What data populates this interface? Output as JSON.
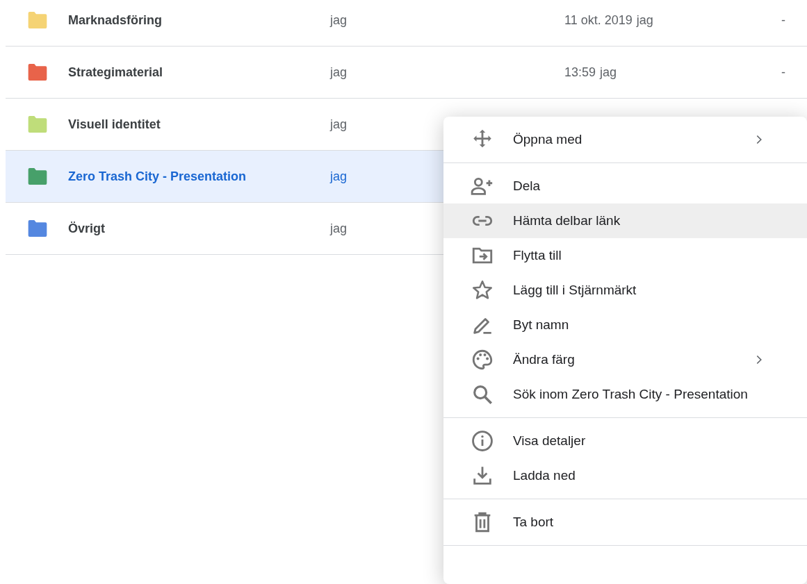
{
  "files": [
    {
      "name": "Marknadsföring",
      "color": "#f5d374",
      "owner": "jag",
      "modified": "11 okt. 2019",
      "modified_by": "jag",
      "size": "-",
      "selected": false
    },
    {
      "name": "Strategimaterial",
      "color": "#e8634a",
      "owner": "jag",
      "modified": "13:59",
      "modified_by": "jag",
      "size": "-",
      "selected": false
    },
    {
      "name": "Visuell identitet",
      "color": "#bfdd7a",
      "owner": "jag",
      "selected": false
    },
    {
      "name": "Zero Trash City - Presentation",
      "color": "#47a06a",
      "owner": "jag",
      "selected": true
    },
    {
      "name": "Övrigt",
      "color": "#5487e0",
      "owner": "jag",
      "selected": false
    }
  ],
  "context_menu": {
    "sections": [
      {
        "items": [
          {
            "kind": "open-with",
            "label": "Öppna med",
            "submenu": true,
            "highlighted": false
          }
        ]
      },
      {
        "items": [
          {
            "kind": "share",
            "label": "Dela",
            "submenu": false,
            "highlighted": false
          },
          {
            "kind": "link",
            "label": "Hämta delbar länk",
            "submenu": false,
            "highlighted": true
          },
          {
            "kind": "move",
            "label": "Flytta till",
            "submenu": false,
            "highlighted": false
          },
          {
            "kind": "star",
            "label": "Lägg till i Stjärnmärkt",
            "submenu": false,
            "highlighted": false
          },
          {
            "kind": "rename",
            "label": "Byt namn",
            "submenu": false,
            "highlighted": false
          },
          {
            "kind": "palette",
            "label": "Ändra färg",
            "submenu": true,
            "highlighted": false
          },
          {
            "kind": "search",
            "label": "Sök inom Zero Trash City - Presentation",
            "submenu": false,
            "highlighted": false
          }
        ]
      },
      {
        "items": [
          {
            "kind": "info",
            "label": "Visa detaljer",
            "submenu": false,
            "highlighted": false
          },
          {
            "kind": "download",
            "label": "Ladda ned",
            "submenu": false,
            "highlighted": false
          }
        ]
      },
      {
        "items": [
          {
            "kind": "trash",
            "label": "Ta bort",
            "submenu": false,
            "highlighted": false
          }
        ]
      }
    ]
  }
}
